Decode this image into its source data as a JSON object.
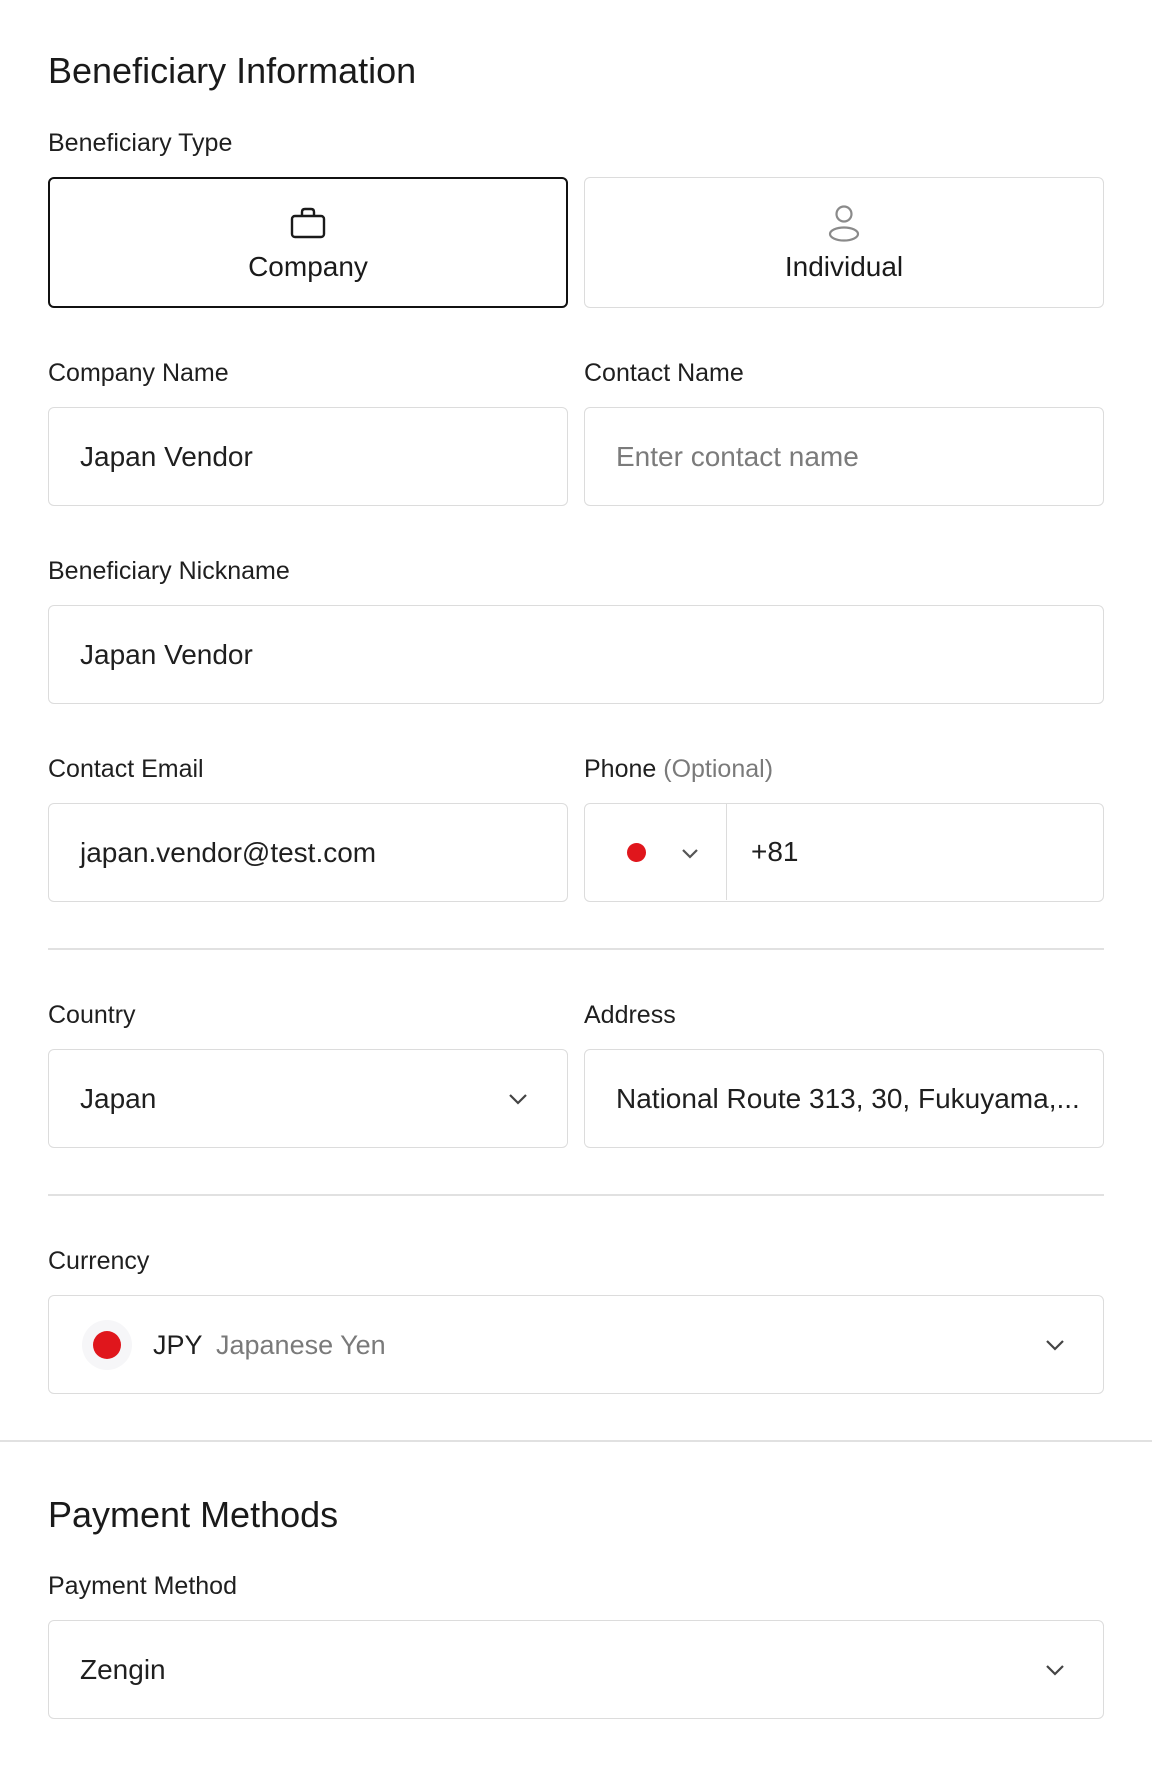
{
  "beneficiary": {
    "title": "Beneficiary Information",
    "type_label": "Beneficiary Type",
    "types": [
      {
        "label": "Company",
        "selected": true,
        "icon": "briefcase-icon"
      },
      {
        "label": "Individual",
        "selected": false,
        "icon": "person-icon"
      }
    ],
    "company_name": {
      "label": "Company Name",
      "value": "Japan Vendor"
    },
    "contact_name": {
      "label": "Contact Name",
      "placeholder": "Enter contact name"
    },
    "nickname": {
      "label": "Beneficiary Nickname",
      "value": "Japan Vendor"
    },
    "contact_email": {
      "label": "Contact Email",
      "value": "japan.vendor@test.com"
    },
    "phone": {
      "label": "Phone",
      "optional": "(Optional)",
      "country_flag": "japan-flag",
      "value": "+81"
    },
    "country": {
      "label": "Country",
      "value": "Japan"
    },
    "address": {
      "label": "Address",
      "value": "National Route 313, 30, Fukuyama,..."
    },
    "currency": {
      "label": "Currency",
      "code": "JPY",
      "name": "Japanese Yen",
      "flag": "japan-flag"
    }
  },
  "payment": {
    "title": "Payment Methods",
    "method_label": "Payment Method",
    "method_value": "Zengin"
  },
  "colors": {
    "flag_red": "#e0161c",
    "border": "#dcdcdc",
    "selected_border": "#111111"
  }
}
